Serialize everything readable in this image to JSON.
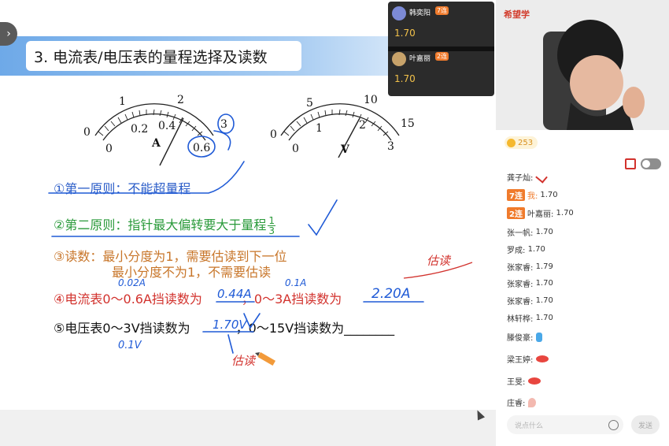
{
  "slide": {
    "title": "3. 电流表/电压表的量程选择及读数",
    "ammeter": {
      "ticks_outer": [
        "0",
        "1",
        "2",
        "3"
      ],
      "ticks_inner": [
        "0",
        "0.2",
        "0.4",
        "0.6"
      ],
      "unit": "A"
    },
    "voltmeter": {
      "ticks_outer": [
        "0",
        "5",
        "10",
        "15"
      ],
      "ticks_inner": [
        "0",
        "1",
        "2",
        "3"
      ],
      "unit": "V"
    },
    "rule1": "①第一原则：不能超量程",
    "rule2": "②第二原则：指针最大偏转要大于量程",
    "rule2_frac_num": "1",
    "rule2_frac_den": "3",
    "reading_line1": "③读数：最小分度为1，需要估读到下一位",
    "reading_line2": "最小分度不为1，不需要估读",
    "item4_a": "④电流表0～0.6A挡读数为",
    "item4_b": "，0～3A挡读数为",
    "item5_a": "⑤电压表0～3V挡读数为",
    "item5_b": "，0～15V挡读数为",
    "blank": "________"
  },
  "annotations": {
    "note_002A": "0.02A",
    "ans_044A": "0.44A",
    "note_01A": "0.1A",
    "ans_220A": "2.20A",
    "note_estimate": "估读",
    "ans_170V": "1.70V",
    "note_01V": "0.1V",
    "note_estimate2": "估读"
  },
  "overlay": {
    "items": [
      {
        "name": "韩奕阳",
        "badge": "7连",
        "value": "1.70"
      },
      {
        "name": "叶嘉丽",
        "badge": "2连",
        "value": "1.70"
      }
    ]
  },
  "brand": "希望学",
  "coins": "253",
  "chat": [
    {
      "user": "龚子灿:",
      "text": ""
    },
    {
      "badge": "7连",
      "me": "我:",
      "text": "1.70"
    },
    {
      "badge": "2连",
      "user": "叶嘉丽:",
      "text": "1.70"
    },
    {
      "user": "张一帆:",
      "text": "1.70"
    },
    {
      "user": "罗成:",
      "text": "1.70"
    },
    {
      "user": "张家睿:",
      "text": "1.79"
    },
    {
      "user": "张家睿:",
      "text": "1.70"
    },
    {
      "user": "张家睿:",
      "text": "1.70"
    },
    {
      "user": "林轩桦:",
      "text": "1.70"
    },
    {
      "user": "滕俊豪:",
      "text": ""
    },
    {
      "user": "梁王婷:",
      "text": ""
    },
    {
      "user": "王旻:",
      "text": ""
    },
    {
      "user": "庄睿:",
      "text": ""
    }
  ],
  "input": {
    "placeholder": "说点什么"
  },
  "send_label": "发送",
  "colors": {
    "accent": "#f07b2c",
    "pen_blue": "#1f5ad6",
    "pen_red": "#d2322d",
    "banner": "#6ea9e8"
  }
}
